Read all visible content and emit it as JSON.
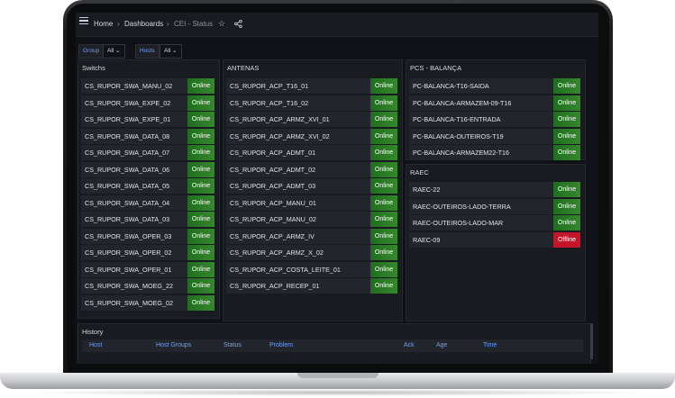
{
  "topbar": {
    "breadcrumb": [
      "Home",
      "Dashboards",
      "CEI - Status"
    ],
    "star_icon": "star-icon",
    "share_icon": "share-icon",
    "menu_icon": "menu-icon"
  },
  "variables": [
    {
      "label": "Group",
      "value": "All"
    },
    {
      "label": "Hosts",
      "value": "All"
    }
  ],
  "panels": {
    "switches": {
      "title": "Switchs",
      "rows": [
        {
          "name": "CS_RUPOR_SWA_MANU_02",
          "status": "Online"
        },
        {
          "name": "CS_RUPOR_SWA_EXPE_02",
          "status": "Online"
        },
        {
          "name": "CS_RUPOR_SWA_EXPE_01",
          "status": "Online"
        },
        {
          "name": "CS_RUPOR_SWA_DATA_08",
          "status": "Online"
        },
        {
          "name": "CS_RUPOR_SWA_DATA_07",
          "status": "Online"
        },
        {
          "name": "CS_RUPOR_SWA_DATA_06",
          "status": "Online"
        },
        {
          "name": "CS_RUPOR_SWA_DATA_05",
          "status": "Online"
        },
        {
          "name": "CS_RUPOR_SWA_DATA_04",
          "status": "Online"
        },
        {
          "name": "CS_RUPOR_SWA_DATA_03",
          "status": "Online"
        },
        {
          "name": "CS_RUPOR_SWA_OPER_03",
          "status": "Online"
        },
        {
          "name": "CS_RUPOR_SWA_OPER_02",
          "status": "Online"
        },
        {
          "name": "CS_RUPOR_SWA_OPER_01",
          "status": "Online"
        },
        {
          "name": "CS_RUPOR_SWA_MOEG_22",
          "status": "Online"
        },
        {
          "name": "CS_RUPOR_SWA_MOEG_02",
          "status": "Online"
        }
      ]
    },
    "antenas": {
      "title": "ANTENAS",
      "rows": [
        {
          "name": "CS_RUPOR_ACP_T16_01",
          "status": "Online"
        },
        {
          "name": "CS_RUPOR_ACP_T16_02",
          "status": "Online"
        },
        {
          "name": "CS_RUPOR_ACP_ARMZ_XVI_01",
          "status": "Online"
        },
        {
          "name": "CS_RUPOR_ACP_ARMZ_XVI_02",
          "status": "Online"
        },
        {
          "name": "CS_RUPOR_ACP_ADMT_01",
          "status": "Online"
        },
        {
          "name": "CS_RUPOR_ACP_ADMT_02",
          "status": "Online"
        },
        {
          "name": "CS_RUPOR_ACP_ADMT_03",
          "status": "Online"
        },
        {
          "name": "CS_RUPOR_ACP_MANU_01",
          "status": "Online"
        },
        {
          "name": "CS_RUPOR_ACP_MANU_02",
          "status": "Online"
        },
        {
          "name": "CS_RUPOR_ACP_ARMZ_IV",
          "status": "Online"
        },
        {
          "name": "CS_RUPOR_ACP_ARMZ_X_02",
          "status": "Online"
        },
        {
          "name": "CS_RUPOR_ACP_COSTA_LEITE_01",
          "status": "Online"
        },
        {
          "name": "CS_RUPOR_ACP_RECEP_01",
          "status": "Online"
        }
      ]
    },
    "pcs": {
      "title": "PCS - BALANÇA",
      "rows": [
        {
          "name": "PC-BALANCA-T16-SAIDA",
          "status": "Online"
        },
        {
          "name": "PC-BALANCA-ARMAZEM-09-T16",
          "status": "Online"
        },
        {
          "name": "PC-BALANCA-T16-ENTRADA",
          "status": "Online"
        },
        {
          "name": "PC-BALANCA-OUTEIROS-T19",
          "status": "Online"
        },
        {
          "name": "PC-BALANCA-ARMAZEM22-T16",
          "status": "Online"
        }
      ]
    },
    "raec": {
      "title": "RAEC",
      "rows": [
        {
          "name": "RAEC-22",
          "status": "Online"
        },
        {
          "name": "RAEC-OUTEIROS-LADO-TERRA",
          "status": "Online"
        },
        {
          "name": "RAEC-OUTEIROS-LADO-MAR",
          "status": "Online"
        },
        {
          "name": "RAEC-09",
          "status": "Offline"
        }
      ]
    },
    "history": {
      "title": "History",
      "columns": [
        "Host",
        "Host Groups",
        "Status",
        "Problem",
        "Ack",
        "Age",
        "Time"
      ]
    }
  },
  "colors": {
    "online": "#37872d",
    "offline": "#c4162a",
    "link": "#6e9fff",
    "background": "#111217"
  }
}
